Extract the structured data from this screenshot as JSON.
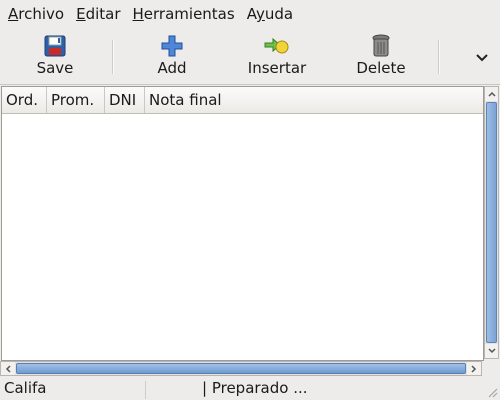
{
  "menu": {
    "items": [
      {
        "mnemonic": "A",
        "rest": "rchivo"
      },
      {
        "mnemonic": "E",
        "rest": "ditar"
      },
      {
        "mnemonic": "H",
        "rest": "erramientas"
      },
      {
        "mnemonic": "y",
        "rest": "uda",
        "prefix": "A"
      }
    ]
  },
  "toolbar": {
    "save_label": "Save",
    "add_label": "Add",
    "insert_label": "Insertar",
    "delete_label": "Delete"
  },
  "table": {
    "columns": [
      "Ord.",
      "Prom.",
      "DNI",
      "Nota final"
    ],
    "rows": []
  },
  "status": {
    "left": "Califa",
    "right": "| Preparado ..."
  },
  "colors": {
    "scroll_thumb": "#7ba3d6",
    "add_icon": "#3a6fc4"
  }
}
